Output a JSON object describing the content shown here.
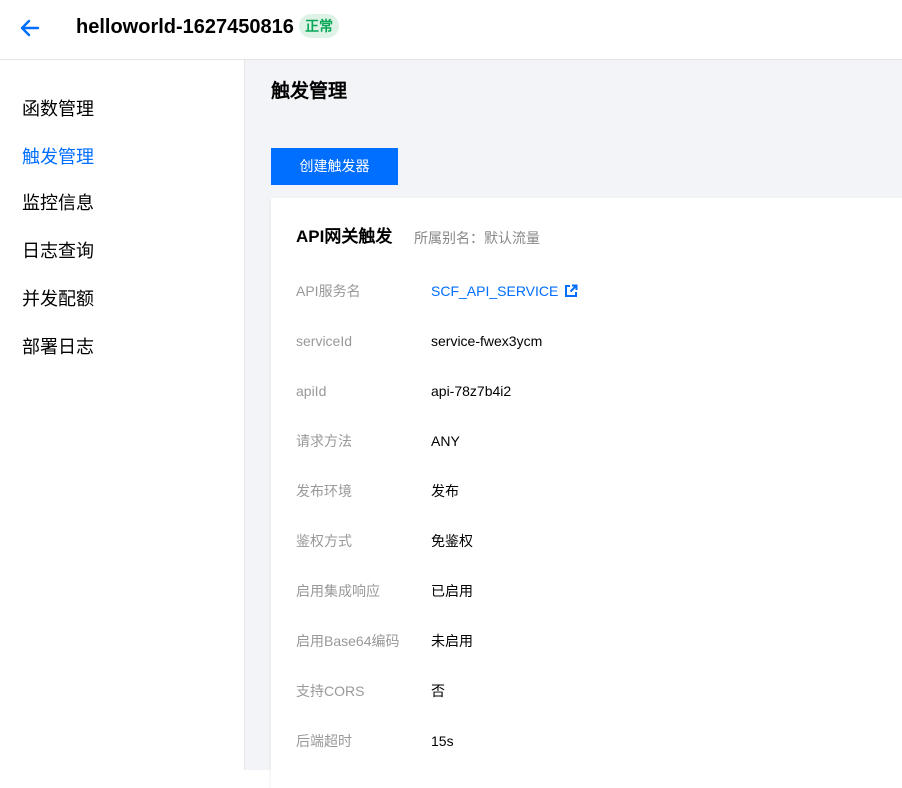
{
  "header": {
    "function_name": "helloworld-1627450816",
    "status": "正常",
    "back_icon": "arrow-left-icon"
  },
  "colors": {
    "accent": "#006eff",
    "status_bg": "#dff2e6",
    "status_text": "#0aa858"
  },
  "sidebar": {
    "items": [
      {
        "label": "函数管理",
        "active": false
      },
      {
        "label": "触发管理",
        "active": true
      },
      {
        "label": "监控信息",
        "active": false
      },
      {
        "label": "日志查询",
        "active": false
      },
      {
        "label": "并发配额",
        "active": false
      },
      {
        "label": "部署日志",
        "active": false
      }
    ]
  },
  "main": {
    "title": "触发管理",
    "create_button": "创建触发器",
    "trigger": {
      "title": "API网关触发",
      "alias_label": "所属别名：",
      "alias_value": "默认流量",
      "rows": [
        {
          "label": "API服务名",
          "value": "SCF_API_SERVICE",
          "link": true
        },
        {
          "label": "serviceId",
          "value": "service-fwex3ycm"
        },
        {
          "label": "apiId",
          "value": "api-78z7b4i2"
        },
        {
          "label": "请求方法",
          "value": "ANY"
        },
        {
          "label": "发布环境",
          "value": "发布"
        },
        {
          "label": "鉴权方式",
          "value": "免鉴权"
        },
        {
          "label": "启用集成响应",
          "value": "已启用"
        },
        {
          "label": "启用Base64编码",
          "value": "未启用"
        },
        {
          "label": "支持CORS",
          "value": "否"
        },
        {
          "label": "后端超时",
          "value": "15s"
        }
      ]
    }
  }
}
